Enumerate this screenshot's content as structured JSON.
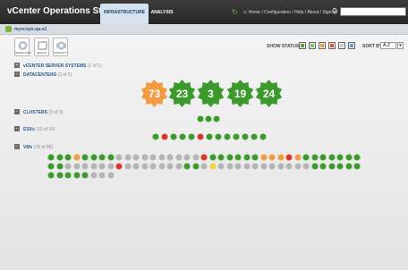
{
  "header": {
    "title": "vCenter Operations Standard",
    "tabs": [
      "INFRASTRUCTURE",
      "ANALYSIS"
    ],
    "links": "Home / Configuration / Help / About / Signout"
  },
  "breadcrumb": "myvcops-qa-a1",
  "toolbar": {
    "view_buttons": [
      "WORKLOAD",
      "HEALTH",
      "CAPACITY"
    ],
    "show_status_label": "SHOW STATUS",
    "sort_label": "SORT BY:",
    "sort_value": "A-Z"
  },
  "status_colors": [
    "#55a532",
    "#7fc65a",
    "#f29b42",
    "#e94d35",
    "#c8c8c8",
    "#5e9ed6"
  ],
  "sections": [
    {
      "label": "vCENTER SERVER SYSTEMS",
      "count": "(1 of 1)"
    },
    {
      "label": "DATACENTERS",
      "count": "(2 of 5)"
    },
    {
      "label": "CLUSTERS",
      "count": "(3 of 3)"
    },
    {
      "label": "ESXs",
      "count": "(13 of 16)"
    },
    {
      "label": "VMs",
      "count": "(78 of 86)"
    }
  ],
  "datacenters": [
    {
      "value": "73",
      "color": "#f29b42"
    },
    {
      "value": "23",
      "color": "#3c9a2c"
    },
    {
      "value": "3",
      "color": "#3c9a2c"
    },
    {
      "value": "19",
      "color": "#3c9a2c"
    },
    {
      "value": "24",
      "color": "#3c9a2c"
    }
  ],
  "clusters": [
    "g",
    "g",
    "g"
  ],
  "esxs": [
    "g",
    "r",
    "g",
    "g",
    "g",
    "r",
    "g",
    "g",
    "g",
    "g",
    "g",
    "g",
    "g"
  ],
  "vms": {
    "rows": [
      [
        "g",
        "g",
        "g",
        "o",
        "g",
        "g",
        "g",
        "g",
        "s",
        "s",
        "s",
        "s",
        "s",
        "s",
        "s",
        "s",
        "s",
        "s",
        "r",
        "g",
        "g",
        "g",
        "g",
        "g",
        "g",
        "o",
        "o",
        "o",
        "r",
        "o",
        "g",
        "g",
        "g",
        "g",
        "g",
        "g",
        "g"
      ],
      [
        "g",
        "g",
        "s",
        "s",
        "s",
        "s",
        "s",
        "s",
        "r",
        "s",
        "s",
        "s",
        "s",
        "s",
        "s",
        "s",
        "g",
        "g",
        "s",
        "y",
        "s",
        "s",
        "s",
        "s",
        "s",
        "s",
        "s",
        "s",
        "s",
        "s",
        "s",
        "g",
        "g",
        "g",
        "g",
        "g",
        "g"
      ],
      [
        "g",
        "g",
        "g",
        "g",
        "g",
        "s",
        "s",
        "s"
      ]
    ]
  }
}
